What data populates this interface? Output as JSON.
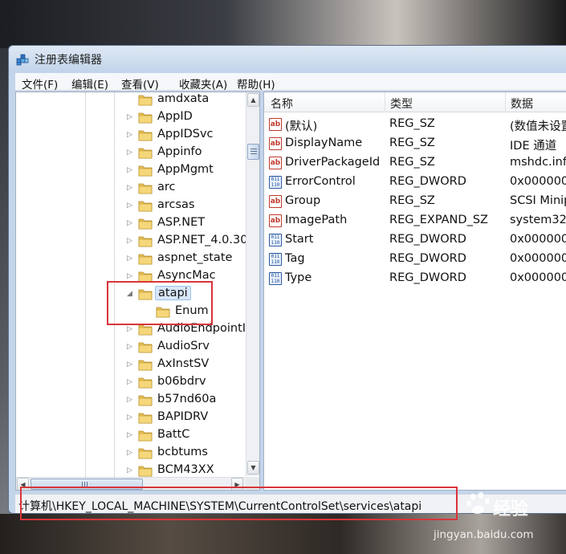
{
  "window": {
    "title": "注册表编辑器",
    "app_icon": "registry-editor-icon"
  },
  "menu": [
    {
      "label": "文件(F)"
    },
    {
      "label": "编辑(E)"
    },
    {
      "label": "查看(V)"
    },
    {
      "label": "收藏夹(A)"
    },
    {
      "label": "帮助(H)"
    }
  ],
  "tree": {
    "items": [
      {
        "label": "amdxata",
        "expander": "none"
      },
      {
        "label": "AppID",
        "expander": "collapsed"
      },
      {
        "label": "AppIDSvc",
        "expander": "collapsed"
      },
      {
        "label": "Appinfo",
        "expander": "collapsed"
      },
      {
        "label": "AppMgmt",
        "expander": "collapsed"
      },
      {
        "label": "arc",
        "expander": "collapsed"
      },
      {
        "label": "arcsas",
        "expander": "collapsed"
      },
      {
        "label": "ASP.NET",
        "expander": "collapsed"
      },
      {
        "label": "ASP.NET_4.0.30",
        "expander": "collapsed"
      },
      {
        "label": "aspnet_state",
        "expander": "collapsed"
      },
      {
        "label": "AsyncMac",
        "expander": "collapsed"
      },
      {
        "label": "atapi",
        "expander": "expanded",
        "selected": true
      },
      {
        "label": "Enum",
        "expander": "none",
        "child": true
      },
      {
        "label": "AudioEndpointI",
        "expander": "collapsed"
      },
      {
        "label": "AudioSrv",
        "expander": "collapsed"
      },
      {
        "label": "AxInstSV",
        "expander": "collapsed"
      },
      {
        "label": "b06bdrv",
        "expander": "collapsed"
      },
      {
        "label": "b57nd60a",
        "expander": "collapsed"
      },
      {
        "label": "BAPIDRV",
        "expander": "collapsed"
      },
      {
        "label": "BattC",
        "expander": "collapsed"
      },
      {
        "label": "bcbtums",
        "expander": "collapsed"
      },
      {
        "label": "BCM43XX",
        "expander": "collapsed"
      }
    ]
  },
  "list": {
    "columns": {
      "name": "名称",
      "type": "类型",
      "data": "数据"
    },
    "rows": [
      {
        "icon": "string-value-icon",
        "name": "(默认)",
        "type": "REG_SZ",
        "data": "(数值未设置"
      },
      {
        "icon": "string-value-icon",
        "name": "DisplayName",
        "type": "REG_SZ",
        "data": "IDE 通道"
      },
      {
        "icon": "string-value-icon",
        "name": "DriverPackageId",
        "type": "REG_SZ",
        "data": "mshdc.inf"
      },
      {
        "icon": "binary-value-icon",
        "name": "ErrorControl",
        "type": "REG_DWORD",
        "data": "0x000000"
      },
      {
        "icon": "string-value-icon",
        "name": "Group",
        "type": "REG_SZ",
        "data": "SCSI Minip"
      },
      {
        "icon": "string-value-icon",
        "name": "ImagePath",
        "type": "REG_EXPAND_SZ",
        "data": "system32\\"
      },
      {
        "icon": "binary-value-icon",
        "name": "Start",
        "type": "REG_DWORD",
        "data": "0x000000"
      },
      {
        "icon": "binary-value-icon",
        "name": "Tag",
        "type": "REG_DWORD",
        "data": "0x000000"
      },
      {
        "icon": "binary-value-icon",
        "name": "Type",
        "type": "REG_DWORD",
        "data": "0x000000"
      }
    ]
  },
  "status": {
    "path": "计算机\\HKEY_LOCAL_MACHINE\\SYSTEM\\CurrentControlSet\\services\\atapi"
  },
  "watermark": {
    "brand": "经验",
    "url": "jingyan.baidu.com"
  },
  "colors": {
    "highlight": "#d9343a",
    "selection": "#d8e7f8",
    "folder": "#e8c15a"
  }
}
